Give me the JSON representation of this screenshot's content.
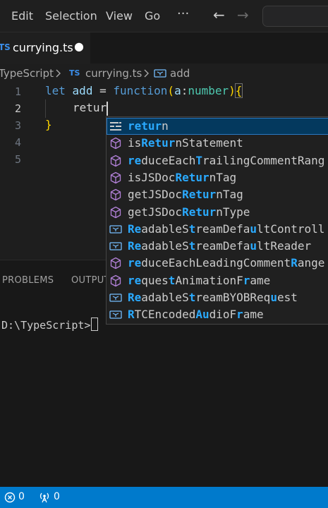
{
  "menu": [
    "Edit",
    "Selection",
    "View",
    "Go",
    "···"
  ],
  "nav": {
    "back": "←",
    "forward": "→"
  },
  "tab": {
    "badge": "TS",
    "label": "currying.ts",
    "dirty": "●"
  },
  "breadcrumb": {
    "folder": "TypeScript",
    "badge": "TS",
    "file": "currying.ts",
    "symbol": "add"
  },
  "editor": {
    "line_numbers": [
      "1",
      "2",
      "3",
      "4",
      "5"
    ],
    "current_line": "2",
    "code": {
      "line1": {
        "kw_let": "let",
        "name": "add",
        "eq": " = ",
        "kw_fn": "function",
        "p1": "(",
        "param": "a",
        "colon": ":",
        "type": "number",
        "p2": ")",
        "brace": "{"
      },
      "line2": {
        "text": "retur"
      },
      "line3": {
        "brace": "}"
      }
    }
  },
  "suggestions": [
    {
      "parts": [
        {
          "t": "retur",
          "h": true
        },
        {
          "t": "n",
          "h": false
        }
      ],
      "icon": "keyword",
      "selected": true
    },
    {
      "parts": [
        {
          "t": "is",
          "h": false
        },
        {
          "t": "Retur",
          "h": true
        },
        {
          "t": "nStatement",
          "h": false
        }
      ],
      "icon": "method"
    },
    {
      "parts": [
        {
          "t": "re",
          "h": true
        },
        {
          "t": "duceEach",
          "h": false
        },
        {
          "t": "T",
          "h": true
        },
        {
          "t": "railingCommentRang",
          "h": false
        }
      ],
      "icon": "method"
    },
    {
      "parts": [
        {
          "t": "isJSDoc",
          "h": false
        },
        {
          "t": "Retur",
          "h": true
        },
        {
          "t": "nTag",
          "h": false
        }
      ],
      "icon": "method"
    },
    {
      "parts": [
        {
          "t": "getJSDoc",
          "h": false
        },
        {
          "t": "Retur",
          "h": true
        },
        {
          "t": "nTag",
          "h": false
        }
      ],
      "icon": "method"
    },
    {
      "parts": [
        {
          "t": "getJSDoc",
          "h": false
        },
        {
          "t": "Retur",
          "h": true
        },
        {
          "t": "nType",
          "h": false
        }
      ],
      "icon": "method"
    },
    {
      "parts": [
        {
          "t": "Re",
          "h": true
        },
        {
          "t": "adableS",
          "h": false
        },
        {
          "t": "t",
          "h": true
        },
        {
          "t": "reamDefa",
          "h": false
        },
        {
          "t": "u",
          "h": true
        },
        {
          "t": "ltControll",
          "h": false
        }
      ],
      "icon": "variable"
    },
    {
      "parts": [
        {
          "t": "Re",
          "h": true
        },
        {
          "t": "adableS",
          "h": false
        },
        {
          "t": "t",
          "h": true
        },
        {
          "t": "reamDefa",
          "h": false
        },
        {
          "t": "u",
          "h": true
        },
        {
          "t": "ltReader",
          "h": false
        }
      ],
      "icon": "variable"
    },
    {
      "parts": [
        {
          "t": "re",
          "h": true
        },
        {
          "t": "duceEachLeadingComment",
          "h": false
        },
        {
          "t": "R",
          "h": true
        },
        {
          "t": "ange",
          "h": false
        }
      ],
      "icon": "method"
    },
    {
      "parts": [
        {
          "t": "re",
          "h": true
        },
        {
          "t": "ques",
          "h": false
        },
        {
          "t": "t",
          "h": true
        },
        {
          "t": "AnimationF",
          "h": false
        },
        {
          "t": "r",
          "h": true
        },
        {
          "t": "ame",
          "h": false
        }
      ],
      "icon": "method"
    },
    {
      "parts": [
        {
          "t": "Re",
          "h": true
        },
        {
          "t": "adableS",
          "h": false
        },
        {
          "t": "t",
          "h": true
        },
        {
          "t": "reamBYOBReq",
          "h": false
        },
        {
          "t": "u",
          "h": true
        },
        {
          "t": "est",
          "h": false
        }
      ],
      "icon": "variable"
    },
    {
      "parts": [
        {
          "t": "R",
          "h": true
        },
        {
          "t": "TCEncoded",
          "h": false
        },
        {
          "t": "Au",
          "h": true
        },
        {
          "t": "dioF",
          "h": false
        },
        {
          "t": "r",
          "h": true
        },
        {
          "t": "ame",
          "h": false
        }
      ],
      "icon": "variable"
    }
  ],
  "panel": {
    "tabs": [
      "PROBLEMS",
      "OUTPUT"
    ],
    "terminal_prompt": "D:\\TypeScript>"
  },
  "status": {
    "errors": "0",
    "broadcast": "0"
  },
  "colors": {
    "keyword": "#569cd6",
    "match": "#2aaaff",
    "method_icon": "#b180d7",
    "variable_icon": "#75beff",
    "statusbar": "#007acc"
  }
}
